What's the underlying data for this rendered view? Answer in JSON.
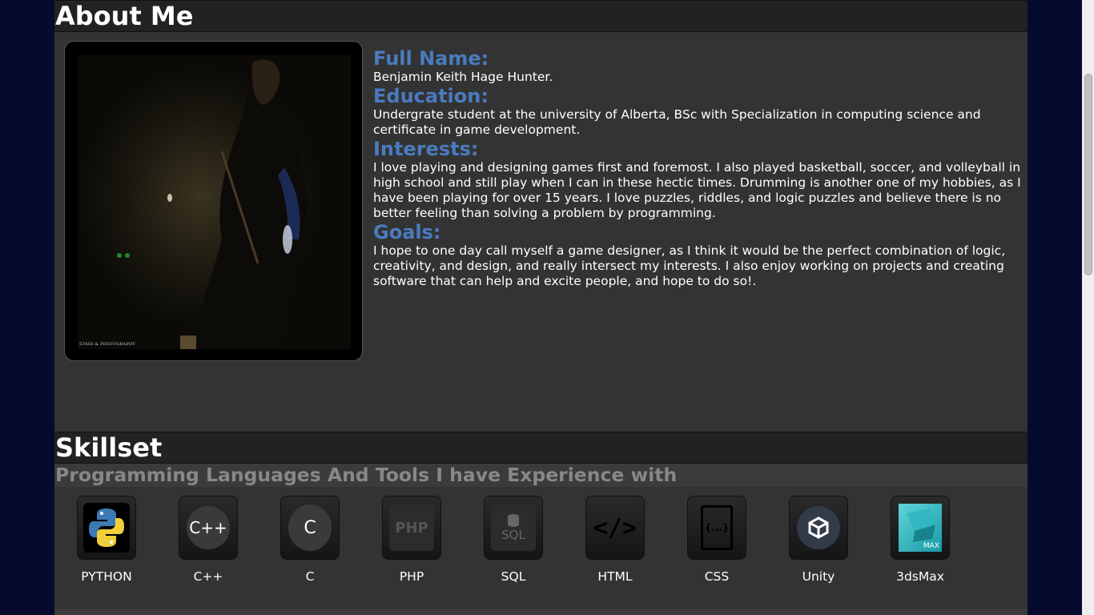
{
  "about": {
    "title": "About Me",
    "photo_credit": "STASS & PHOTOGRAPHY",
    "fields": [
      {
        "heading": "Full Name:",
        "text": "Benjamin Keith Hage Hunter."
      },
      {
        "heading": "Education:",
        "text": "Undergrate student at the university of Alberta, BSc with Specialization in computing science and certificate in game development."
      },
      {
        "heading": "Interests:",
        "text": "I love playing and designing games first and foremost. I also played basketball, soccer, and volleyball in high school and still play when I can in these hectic times. Drumming is another one of my hobbies, as I have been playing for over 15 years. I love puzzles, riddles, and logic puzzles and believe there is no better feeling than solving a problem by programming."
      },
      {
        "heading": "Goals:",
        "text": "I hope to one day call myself a game designer, as I think it would be the perfect combination of logic, creativity, and design, and really intersect my interests. I also enjoy working on projects and creating software that can help and excite people, and hope to do so!."
      }
    ]
  },
  "skillset": {
    "title": "Skillset",
    "subtitle": "Programming Languages And Tools I have Experience with",
    "skills": [
      {
        "label": "PYTHON",
        "icon": "python-icon"
      },
      {
        "label": "C++",
        "icon": "cpp-icon",
        "glyph": "C++"
      },
      {
        "label": "C",
        "icon": "c-icon",
        "glyph": "C"
      },
      {
        "label": "PHP",
        "icon": "php-icon",
        "glyph": "PHP"
      },
      {
        "label": "SQL",
        "icon": "sql-icon",
        "glyph": "SQL"
      },
      {
        "label": "HTML",
        "icon": "html-icon",
        "glyph": "</>"
      },
      {
        "label": "CSS",
        "icon": "css-icon",
        "glyph": "{...}"
      },
      {
        "label": "Unity",
        "icon": "unity-icon"
      },
      {
        "label": "3dsMax",
        "icon": "3dsmax-icon",
        "glyph": "MAX"
      }
    ]
  },
  "colors": {
    "background": "#060b2e",
    "panel": "#333333",
    "header": "#222222",
    "accent": "#4a7bbf"
  }
}
